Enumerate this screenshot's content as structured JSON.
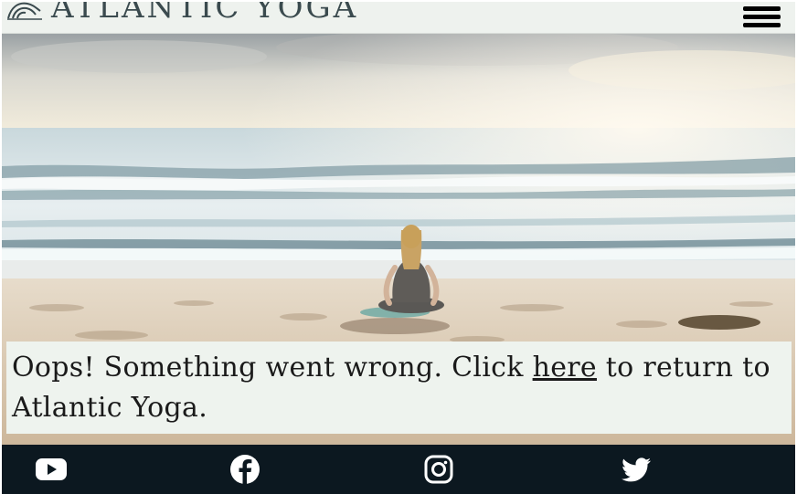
{
  "header": {
    "brand": "ATLANTIC YOGA",
    "logo_icon": "wave-icon",
    "menu_icon": "hamburger-menu-icon"
  },
  "hero": {
    "image": "woman-meditating-on-beach"
  },
  "message": {
    "before_link": "Oops! Something went wrong. Click ",
    "link_text": "here",
    "after_link": " to return to Atlantic Yoga."
  },
  "footer": {
    "icons": [
      "youtube-icon",
      "facebook-icon",
      "instagram-icon",
      "twitter-icon"
    ]
  },
  "colors": {
    "header_bg": "#eef2ee",
    "brand_text": "#3a4a4e",
    "message_bg": "#eef3ee",
    "footer_bg": "#0c1820",
    "icon": "#ffffff"
  }
}
